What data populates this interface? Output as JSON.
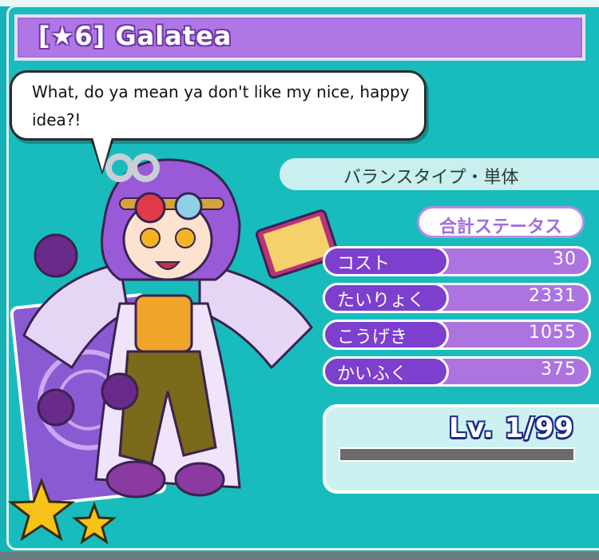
{
  "card": {
    "title": "[★6] Galatea",
    "quote": "What, do ya mean ya don't like my nice, happy idea?!",
    "type_label": "バランスタイプ・単体",
    "rarity_stars": 6
  },
  "status": {
    "header": "合計ステータス",
    "rows": [
      {
        "label": "コスト",
        "value": "30"
      },
      {
        "label": "たいりょく",
        "value": "2331"
      },
      {
        "label": "こうげき",
        "value": "1055"
      },
      {
        "label": "かいふく",
        "value": "375"
      }
    ]
  },
  "level": {
    "text": "Lv. 1/99",
    "current": 1,
    "max": 99,
    "exp_fraction": 0
  },
  "icons": {
    "stars": "star-icon",
    "character": "character-art"
  },
  "colors": {
    "background": "#16b2b5",
    "title_bar": "#b076e6",
    "stat_label": "#7c3fce",
    "stat_track": "#ad74e0",
    "level_text_outline": "#1b2a88",
    "star_fill": "#f6c418"
  }
}
